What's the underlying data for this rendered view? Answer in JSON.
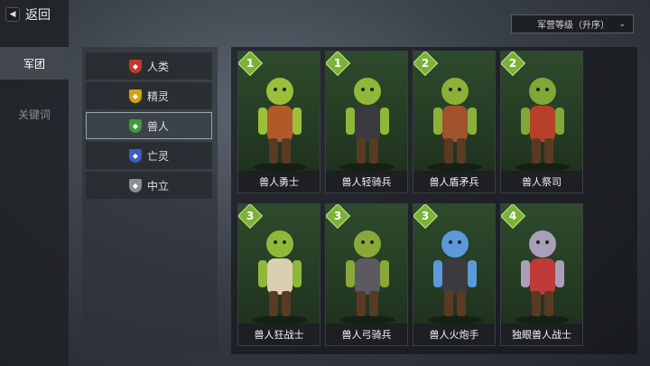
{
  "nav": {
    "back_label": "返回",
    "tabs": [
      {
        "label": "军团",
        "active": true
      },
      {
        "label": "关键词",
        "active": false
      }
    ]
  },
  "sort": {
    "label": "军营等级（升序）",
    "icon": "chevron-down-icon"
  },
  "factions": [
    {
      "label": "人类",
      "color": "#c0392b",
      "icon": "human-faction-icon",
      "selected": false
    },
    {
      "label": "精灵",
      "color": "#d4a017",
      "icon": "elf-faction-icon",
      "selected": false
    },
    {
      "label": "兽人",
      "color": "#3f9a3a",
      "icon": "orc-faction-icon",
      "selected": true
    },
    {
      "label": "亡灵",
      "color": "#3b5fc0",
      "icon": "undead-faction-icon",
      "selected": false
    },
    {
      "label": "中立",
      "color": "#8a8f96",
      "icon": "neutral-faction-icon",
      "selected": false
    }
  ],
  "units": [
    {
      "name": "兽人勇士",
      "level": "1",
      "skin": "#9bbf3a",
      "gear": "#b05a2a"
    },
    {
      "name": "兽人轻骑兵",
      "level": "1",
      "skin": "#8fb83a",
      "gear": "#3a3a40"
    },
    {
      "name": "兽人盾矛兵",
      "level": "2",
      "skin": "#8db03a",
      "gear": "#a0522d"
    },
    {
      "name": "兽人祭司",
      "level": "2",
      "skin": "#7fa836",
      "gear": "#b8402a"
    },
    {
      "name": "兽人狂战士",
      "level": "3",
      "skin": "#8fb83a",
      "gear": "#d8d0b0"
    },
    {
      "name": "兽人弓骑兵",
      "level": "3",
      "skin": "#8aa838",
      "gear": "#5a5a60"
    },
    {
      "name": "兽人火炮手",
      "level": "3",
      "skin": "#5a9ad8",
      "gear": "#3a3a40"
    },
    {
      "name": "独眼兽人战士",
      "level": "4",
      "skin": "#a8a0b8",
      "gear": "#c03a3a"
    }
  ],
  "colors": {
    "badge": "#7bb23a",
    "card_bg": "#2e4a2c"
  }
}
